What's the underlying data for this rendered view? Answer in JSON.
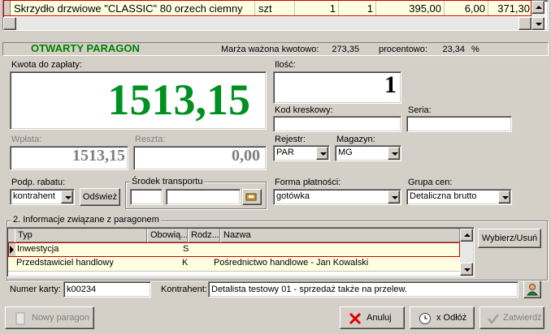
{
  "top_row": {
    "name": "Skrzydło drzwiowe \"CLASSIC\" 80 orzech ciemny",
    "unit": "szt",
    "qty1": "1",
    "qty2": "1",
    "price": "395,00",
    "discount": "6,00",
    "value": "371,30"
  },
  "status": {
    "title": "OTWARTY PARAGON",
    "margin_label": "Marża ważona kwotowo:",
    "margin_value": "273,35",
    "percent_label": "procentowo:",
    "percent_value": "23,34",
    "percent_unit": "%"
  },
  "payment": {
    "amount_label": "Kwota do zapłaty:",
    "amount": "1513,15",
    "paid_label": "Wpłata:",
    "paid": "1513,15",
    "change_label": "Reszta:",
    "change": "0,00"
  },
  "qty": {
    "label": "Ilość:",
    "value": "1"
  },
  "barcode": {
    "label": "Kod kreskowy:",
    "value": ""
  },
  "series": {
    "label": "Seria:",
    "value": ""
  },
  "register": {
    "label": "Rejestr:",
    "value": "PAR"
  },
  "warehouse": {
    "label": "Magazyn:",
    "value": "MG"
  },
  "discount": {
    "label": "Podp. rabatu:",
    "value": "kontrahent",
    "refresh": "Odśwież"
  },
  "transport": {
    "label": "Środek transportu",
    "code": "",
    "name": ""
  },
  "payform": {
    "label": "Forma płatności:",
    "value": "gotówka"
  },
  "pricegroup": {
    "label": "Grupa cen:",
    "value": "Detaliczna brutto"
  },
  "info": {
    "legend": "2. Informacje związane z paragonem",
    "columns": [
      "Typ",
      "Obowią...",
      "Rodz...",
      "Nazwa"
    ],
    "rows": [
      {
        "typ": "Inwestycja",
        "obow": "",
        "rodz": "S",
        "nazwa": ""
      },
      {
        "typ": "Przedstawiciel handlowy",
        "obow": "",
        "rodz": "K",
        "nazwa": "Pośrednictwo handlowe - Jan Kowalski"
      }
    ],
    "select_btn": "Wybierz/Usuń"
  },
  "card": {
    "label": "Numer karty:",
    "value": "k00234"
  },
  "contractor": {
    "label": "Kontrahent:",
    "value": "Detalista testowy 01 - sprzedaż także na przelew."
  },
  "buttons": {
    "new": "Nowy paragon",
    "cancel": "Anuluj",
    "defer": "x Odłóż",
    "confirm": "Zatwierdź"
  },
  "colors": {
    "accent_green": "#008000",
    "selection_border": "#cc0000",
    "row_highlight": "#ffffe0"
  }
}
